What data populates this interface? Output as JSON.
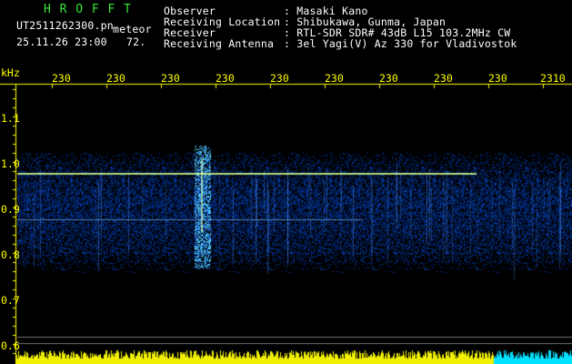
{
  "header": {
    "app_title": "HROFFT",
    "filename": "UT2511262300.pn",
    "meteor_label": "meteor",
    "datetime": "25.11.26 23:00",
    "count": "72.",
    "fields": [
      {
        "label": "Observer",
        "value": ": Masaki Kano"
      },
      {
        "label": "Receiving Location",
        "value": ": Shibukawa, Gunma, Japan"
      },
      {
        "label": "Receiver",
        "value": ": RTL-SDR SDR# 43dB L15 103.2MHz CW"
      },
      {
        "label": "Receiving Antenna",
        "value": ": 3el Yagi(V) Az 330 for Vladivostok"
      }
    ]
  },
  "axis": {
    "unit": "kHz",
    "y_ticks": [
      "1.1",
      "1.0",
      "0.9",
      "0.8",
      "0.7",
      "0.6"
    ],
    "x_ticks": [
      "230",
      "230",
      "230",
      "230",
      "230",
      "230",
      "230",
      "230",
      "230",
      "2310"
    ]
  },
  "colors": {
    "background": "#000000",
    "axis": "#ffff00",
    "text": "#ffffff",
    "title": "#36e636",
    "signal": "#3f7bff",
    "meteor_line": "#ffffa0",
    "bottom_bars": "#f0f000",
    "bottom_bars_right": "#00e0ff"
  }
}
